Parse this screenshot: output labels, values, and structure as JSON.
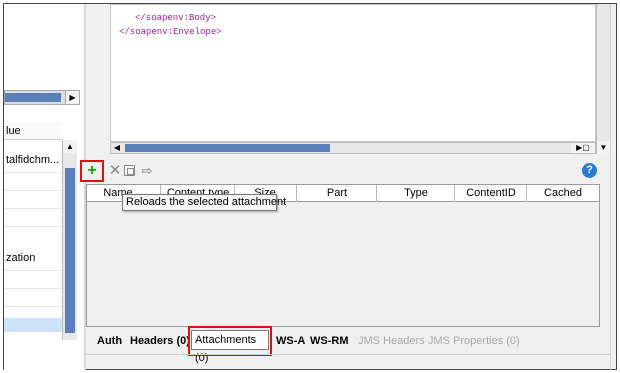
{
  "editor": {
    "lines": [
      "</soapenv:Body>",
      "</soapenv:Envelope>"
    ]
  },
  "left_panel": {
    "column_header": "lue",
    "cell_1": "talfidchm...",
    "cell_2": "zation"
  },
  "attachments": {
    "columns": [
      "Name",
      "Content type",
      "Size",
      "Part",
      "Type",
      "ContentID",
      "Cached"
    ],
    "tooltip": "Reloads the selected attachment"
  },
  "tabs": {
    "auth": "Auth",
    "headers": "Headers (0)",
    "attachments": "Attachments (0)",
    "ws_a": "WS-A",
    "ws_rm": "WS-RM",
    "jms_headers": "JMS Headers",
    "jms_properties": "JMS Properties (0)"
  },
  "colors": {
    "highlight": "#e01010",
    "add_green": "#1fa01f",
    "xml_tag": "#a01ea0",
    "scroll_thumb": "#5b7fb8"
  }
}
